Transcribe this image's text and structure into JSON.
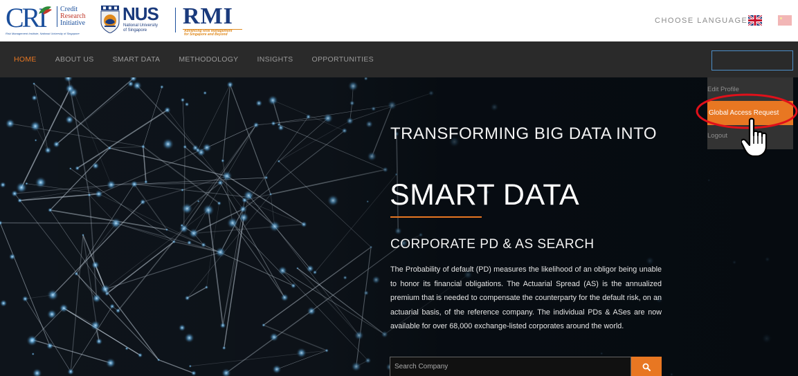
{
  "header": {
    "cri_logo": {
      "mark": "CRI",
      "line1": "Credit",
      "line2": "Research",
      "line3": "Initiative",
      "subtitle": "Risk Management Institute, National University of Singapore"
    },
    "nus_logo": {
      "name": "NUS",
      "line1": "National University",
      "line2": "of Singapore"
    },
    "rmi_logo": {
      "name": "RMI",
      "tagline1": "Advancing Risk Management",
      "tagline2": "for Singapore and Beyond"
    },
    "choose_language": "CHOOSE LANGUAGE",
    "flags": [
      "uk-flag-icon",
      "china-flag-icon"
    ]
  },
  "nav": {
    "items": [
      {
        "label": "HOME",
        "active": true
      },
      {
        "label": "ABOUT US",
        "active": false
      },
      {
        "label": "SMART DATA",
        "active": false
      },
      {
        "label": "METHODOLOGY",
        "active": false
      },
      {
        "label": "INSIGHTS",
        "active": false
      },
      {
        "label": "OPPORTUNITIES",
        "active": false
      }
    ]
  },
  "user_menu": {
    "items": [
      {
        "label": "Edit Profile"
      },
      {
        "label": "Global Access Request",
        "highlighted": true
      },
      {
        "label": "Logout"
      }
    ]
  },
  "hero": {
    "title_line1": "TRANSFORMING BIG DATA INTO",
    "title_big": "SMART DATA",
    "subtitle": "CORPORATE PD & AS SEARCH",
    "description": "The Probability of default (PD) measures the likelihood of an obligor being unable to honor its financial obligations. The Actuarial Spread (AS) is the annualized premium that is needed to compensate the counterparty for the default risk, on an actuarial basis, of the reference company. The individual PDs & ASes are now available for over 68,000 exchange-listed corporates around the world.",
    "search_placeholder": "Search Company"
  },
  "colors": {
    "accent": "#e87722",
    "nav_bg": "#2a2a2a",
    "brand_blue": "#1a3a7c",
    "annotation_red": "#e0101a"
  }
}
